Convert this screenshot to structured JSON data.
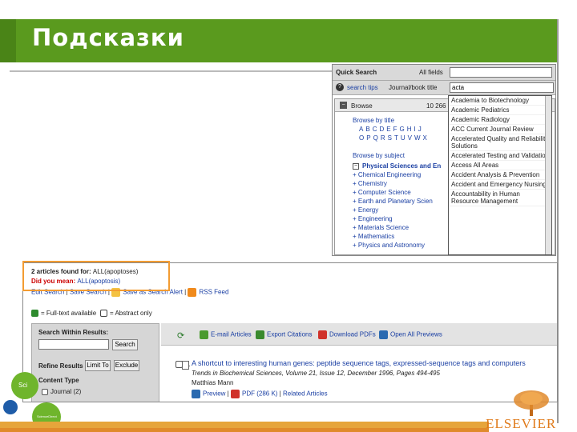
{
  "slide": {
    "title": "Подсказки"
  },
  "quick_search": {
    "title": "Quick Search",
    "all_fields": "All fields",
    "search_tips": "search tips",
    "journal_book_title": "Journal/book title",
    "query_value": "acta"
  },
  "browse": {
    "label": "Browse",
    "count": "10 266",
    "browse_by_title": "Browse by title",
    "letters_row1": [
      "A",
      "B",
      "C",
      "D",
      "E",
      "F",
      "G",
      "H",
      "I",
      "J"
    ],
    "letters_row2": [
      "O",
      "P",
      "Q",
      "R",
      "S",
      "T",
      "U",
      "V",
      "W",
      "X"
    ],
    "browse_by_subject": "Browse by subject",
    "physical_sciences": "Physical Sciences and En",
    "subjects": [
      "Chemical Engineering",
      "Chemistry",
      "Computer Science",
      "Earth and Planetary Scien",
      "Energy",
      "Engineering",
      "Materials Science",
      "Mathematics",
      "Physics and Astronomy"
    ]
  },
  "suggestions": [
    "Academia to Biotechnology",
    "Academic Pediatrics",
    "Academic Radiology",
    "ACC Current Journal Review",
    "Accelerated Quality and Reliability Solutions",
    "Accelerated Testing and Validation",
    "Access All Areas",
    "Accident Analysis & Prevention",
    "Accident and Emergency Nursing",
    "Accountability in Human Resource Management"
  ],
  "results": {
    "found_label": "2 articles found for:",
    "found_query": "ALL(apoptoses)",
    "did_you_mean_label": "Did you mean:",
    "did_you_mean_query": "ALL(apoptosis)",
    "edit_search": "Edit Search",
    "save_search": "Save Search",
    "save_as_alert": "Save as Search Alert",
    "rss_feed": "RSS Feed",
    "full_text": "= Full-text available",
    "abstract_only": "= Abstract only",
    "search_within": "Search Within Results:",
    "search_button": "Search",
    "refine_results": "Refine Results",
    "limit_to": "Limit To",
    "exclude": "Exclude",
    "content_type": "Content Type",
    "journal_count": "Journal (2)",
    "email_articles": "E-mail Articles",
    "export_citations": "Export Citations",
    "download_pdfs": "Download PDFs",
    "open_all_previews": "Open All Previews",
    "item_number": "1.",
    "article_title": "A shortcut to interesting human genes: peptide sequence tags, expressed-sequence tags and computers",
    "citation": "Trends in Biochemical Sciences, Volume 21, Issue 12, December 1996, Pages 494-495",
    "author": "Matthias Mann",
    "preview": "Preview",
    "pdf": "PDF (286 K)",
    "related": "Related Articles"
  },
  "branding": {
    "publisher": "ELSEVIER",
    "sci_badge": "Sci",
    "small_badge": "ScienceDirect"
  },
  "colors": {
    "header": "#5a9a1e",
    "accent_orange": "#f39c32",
    "link_blue": "#1a3fa3",
    "bottom_bar": "#e6a53b"
  }
}
